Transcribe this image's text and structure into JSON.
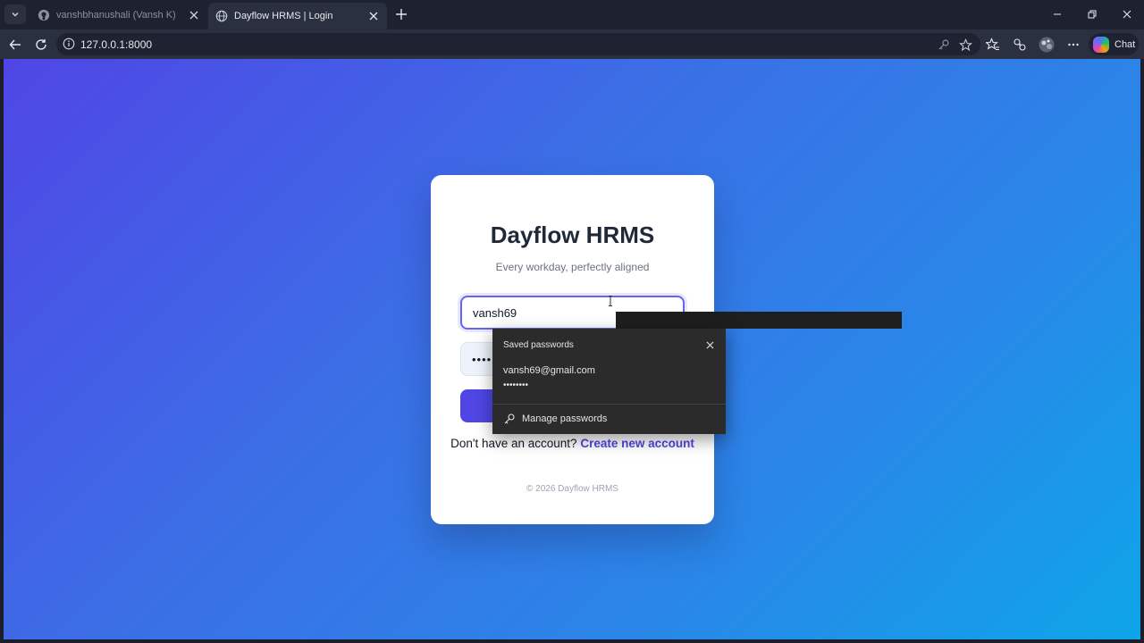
{
  "browser": {
    "tabs": [
      {
        "title": "vanshbhanushali (Vansh K)",
        "icon": "github-icon",
        "active": false
      },
      {
        "title": "Dayflow HRMS | Login",
        "icon": "globe-icon",
        "active": true
      }
    ],
    "address": "127.0.0.1:8000",
    "copilot_label": "Chat"
  },
  "login": {
    "title": "Dayflow HRMS",
    "subtitle": "Every workday, perfectly aligned",
    "username_value": "vansh69",
    "password_mask": "••••",
    "signup_prompt": "Don't have an account?",
    "signup_link": "Create new account",
    "footer": "© 2026 Dayflow HRMS"
  },
  "password_popup": {
    "title": "Saved passwords",
    "email": "vansh69@gmail.com",
    "password_dots": "••••••••",
    "manage_label": "Manage passwords"
  },
  "colors": {
    "accent": "#4f46e5",
    "gradient_start": "#4f46e5",
    "gradient_end": "#0ea5e9"
  }
}
